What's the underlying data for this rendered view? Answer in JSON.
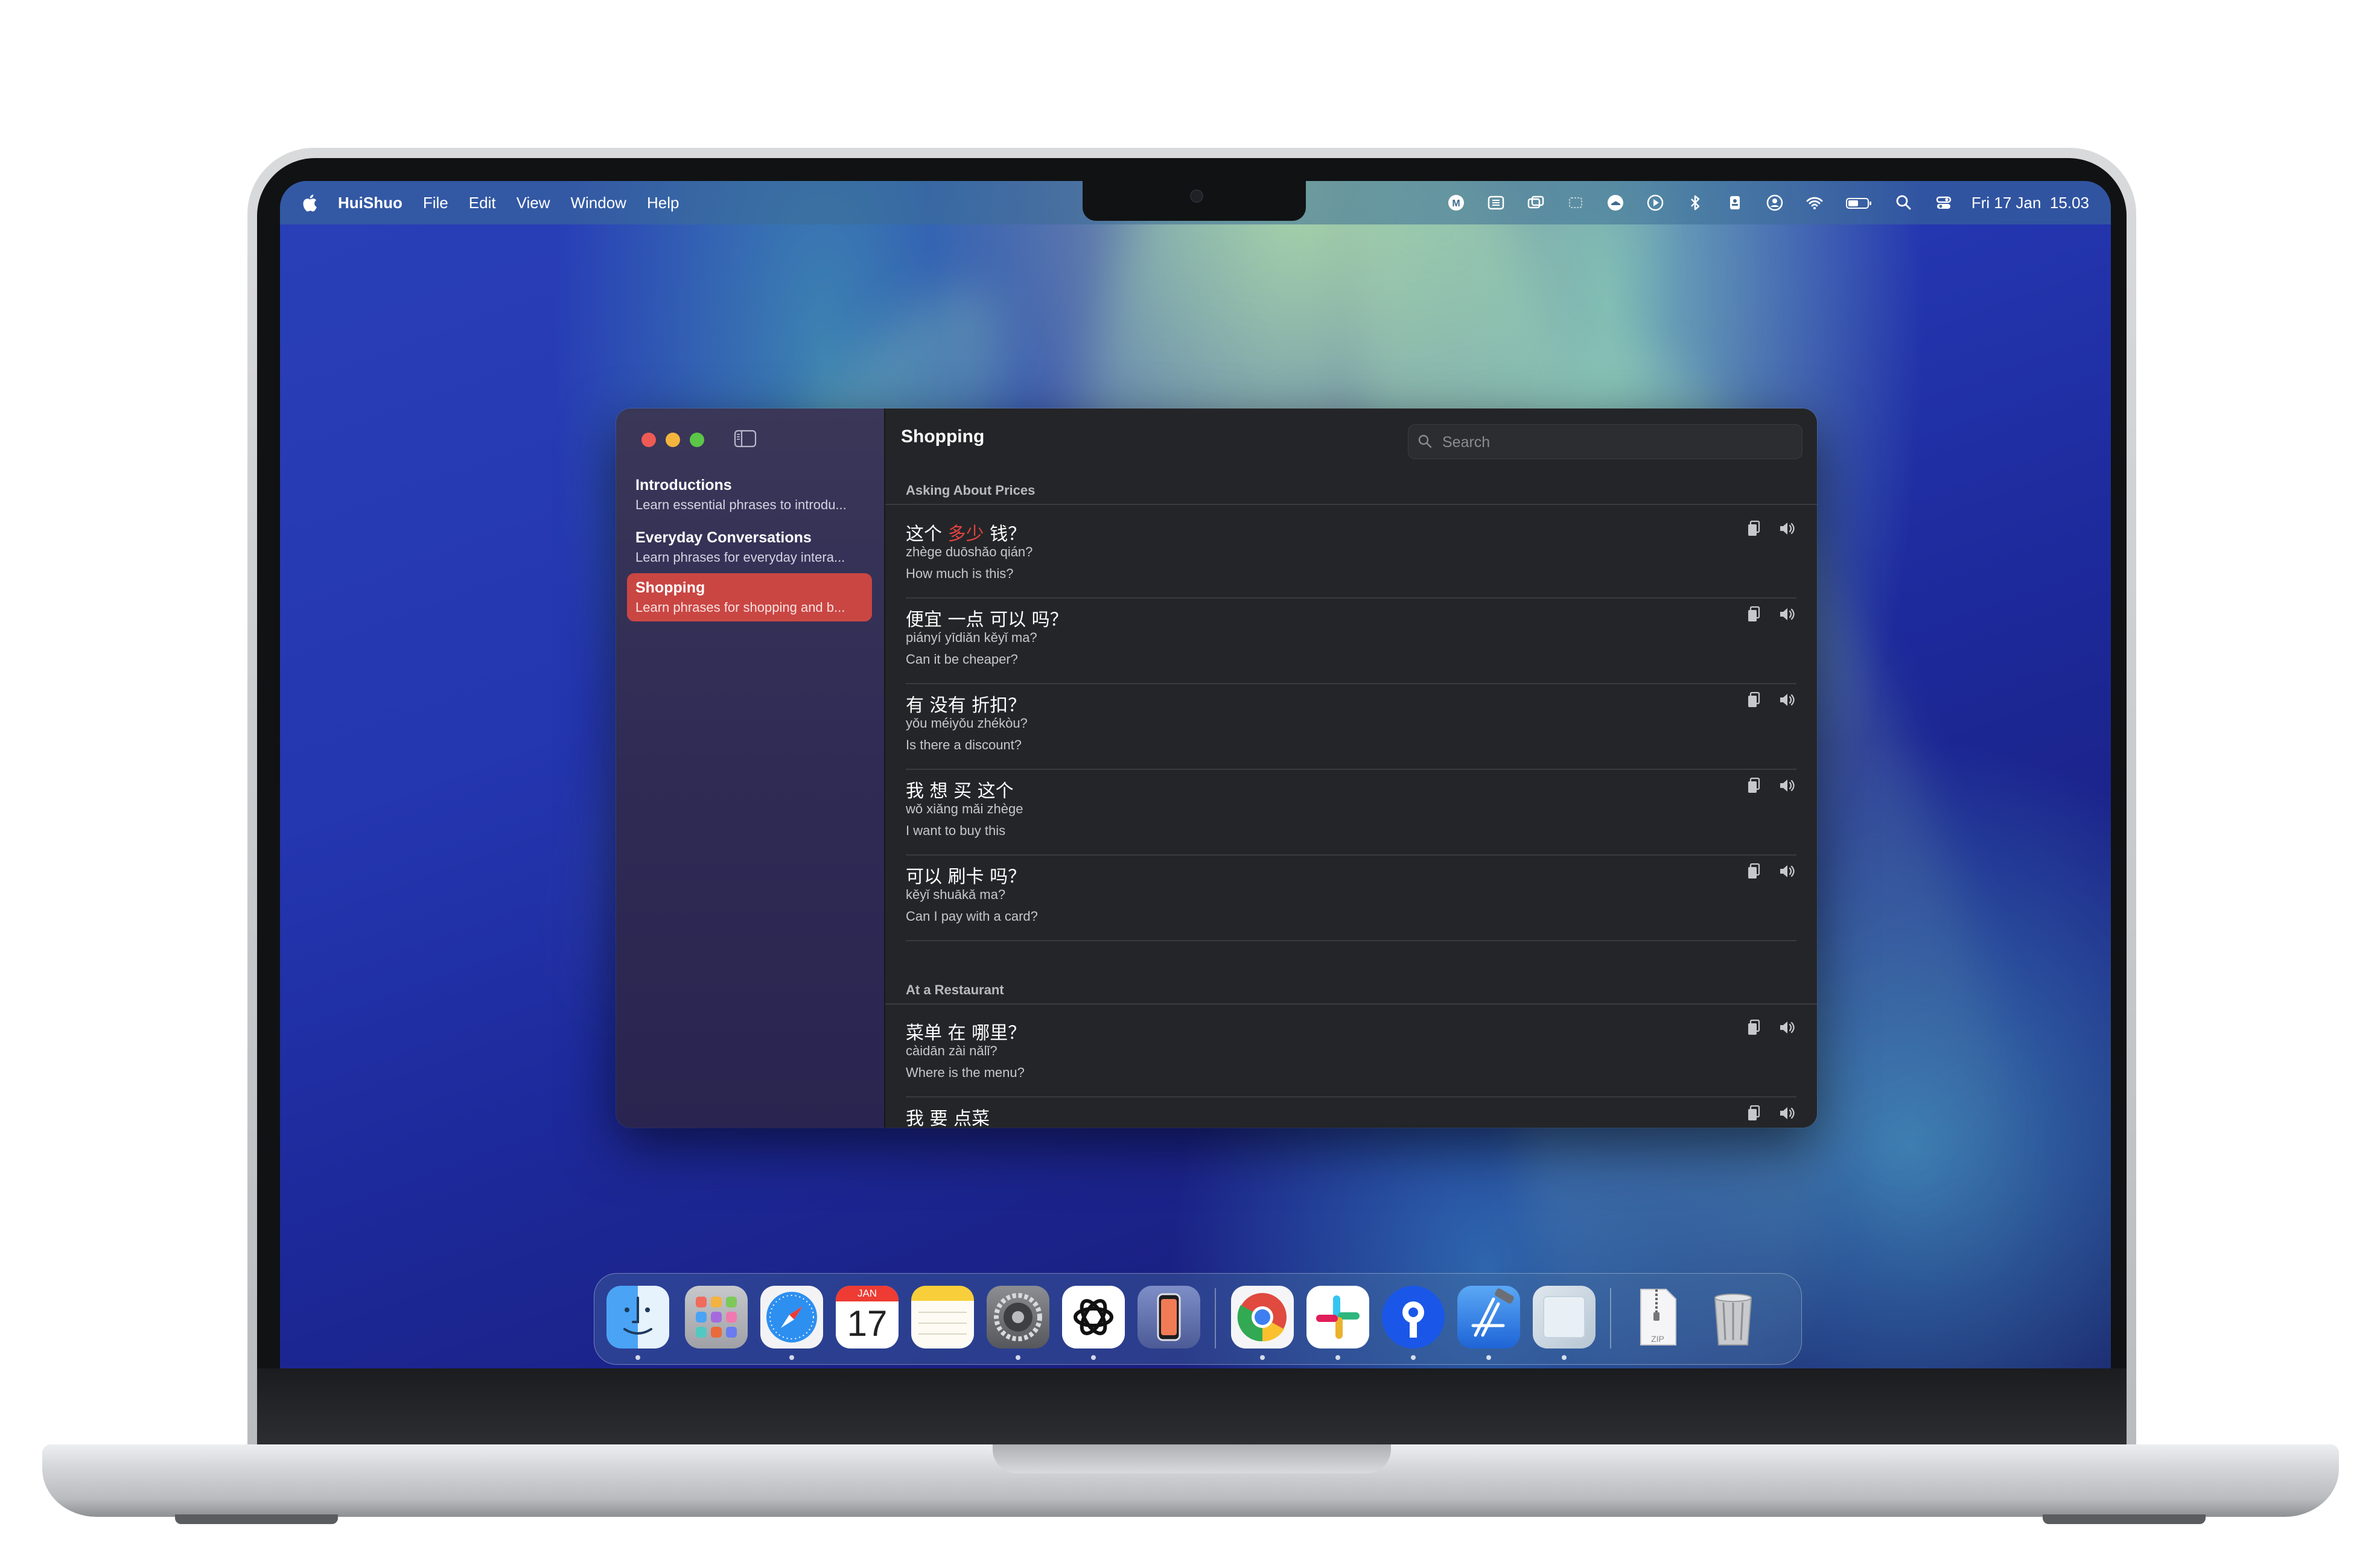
{
  "menubar": {
    "app_name": "HuiShuo",
    "menus": [
      "File",
      "Edit",
      "View",
      "Window",
      "Help"
    ],
    "clock": "Fri 17 Jan  15.03"
  },
  "window": {
    "sidebar": {
      "items": [
        {
          "title": "Introductions",
          "subtitle": "Learn essential phrases to introdu..."
        },
        {
          "title": "Everyday Conversations",
          "subtitle": "Learn phrases for everyday intera..."
        },
        {
          "title": "Shopping",
          "subtitle": "Learn phrases for shopping and b..."
        }
      ],
      "selected_index": 2
    },
    "title": "Shopping",
    "search": {
      "placeholder": "Search",
      "value": ""
    },
    "sections": [
      {
        "header": "Asking About Prices",
        "phrases": [
          {
            "hanzi_before": "这个 ",
            "hanzi_highlight": "多少",
            "hanzi_after": " 钱？",
            "pinyin": "zhège duōshǎo qián?",
            "english": "How much is this?"
          },
          {
            "hanzi_before": "便宜 一点 可以 吗？",
            "hanzi_highlight": "",
            "hanzi_after": "",
            "pinyin": "piányí yīdiǎn kěyǐ ma?",
            "english": "Can it be cheaper?"
          },
          {
            "hanzi_before": "有 没有 折扣？",
            "hanzi_highlight": "",
            "hanzi_after": "",
            "pinyin": "yǒu méiyǒu zhékòu?",
            "english": "Is there a discount?"
          },
          {
            "hanzi_before": "我 想 买 这个",
            "hanzi_highlight": "",
            "hanzi_after": "",
            "pinyin": "wǒ xiǎng mǎi zhège",
            "english": "I want to buy this"
          },
          {
            "hanzi_before": "可以 刷卡 吗？",
            "hanzi_highlight": "",
            "hanzi_after": "",
            "pinyin": "kěyǐ shuākǎ ma?",
            "english": "Can I pay with a card?"
          }
        ]
      },
      {
        "header": "At a Restaurant",
        "phrases": [
          {
            "hanzi_before": "菜单 在 哪里？",
            "hanzi_highlight": "",
            "hanzi_after": "",
            "pinyin": "càidān zài nǎlǐ?",
            "english": "Where is the menu?"
          },
          {
            "hanzi_before": "我 要 点菜",
            "hanzi_highlight": "",
            "hanzi_after": "",
            "pinyin": "",
            "english": ""
          }
        ]
      }
    ]
  },
  "dock": {
    "apps": [
      "finder-icon",
      "launchpad-icon",
      "safari-icon",
      "calendar-icon",
      "notes-icon",
      "system-settings-icon",
      "chatgpt-icon",
      "iphone-mirroring-icon",
      "chrome-icon",
      "slack-icon",
      "location-app-icon",
      "xcode-icon",
      "preview-icon",
      "archive-zip-icon",
      "trash-icon"
    ],
    "calendar_month": "JAN",
    "calendar_day": "17",
    "zip_label": "ZIP"
  },
  "colors": {
    "accent": "#c94643",
    "highlight_text": "#e0443f"
  }
}
